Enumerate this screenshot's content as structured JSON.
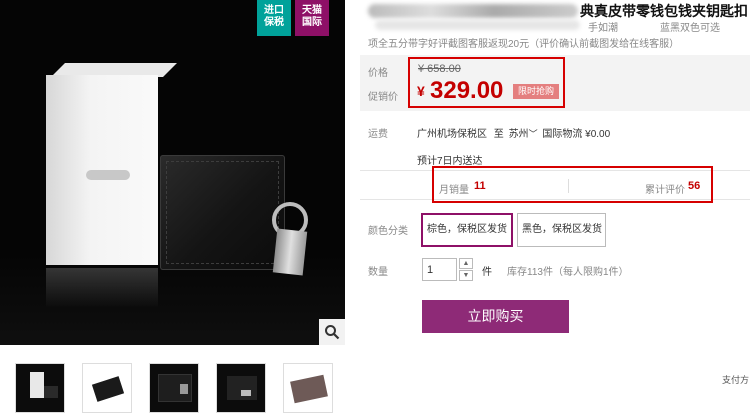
{
  "badges": {
    "import": [
      "进口",
      "保税"
    ],
    "tmall": [
      "天猫",
      "国际"
    ]
  },
  "product": {
    "title_visible": "典真皮带零钱包钱夹钥匙扣",
    "sub_left": "手如潮",
    "sub_right": "蓝黑双色可选",
    "promo": "项全五分带字好评截图客服返现20元（评价确认前截图发给在线客服）"
  },
  "price": {
    "price_label": "价格",
    "original": "¥ 658.00",
    "promo_label": "促销价",
    "currency": "¥",
    "current": "329.00",
    "flash_tag": "限时抢购"
  },
  "shipping": {
    "label": "运费",
    "from": "广州机场保税区",
    "to_word": "至",
    "dest": "苏州",
    "method": "国际物流 ¥0.00",
    "delivery": "预计7日内送达"
  },
  "stats": {
    "sales_label": "月销量",
    "sales_value": "11",
    "reviews_label": "累计评价",
    "reviews_value": "56"
  },
  "options": {
    "label": "颜色分类",
    "items": [
      "棕色，保税区发货",
      "黑色，保税区发货"
    ]
  },
  "quantity": {
    "label": "数量",
    "value": "1",
    "unit": "件",
    "stock": "库存113件（每人限购1件）"
  },
  "buy_button": "立即购买",
  "payment_label": "支付方"
}
